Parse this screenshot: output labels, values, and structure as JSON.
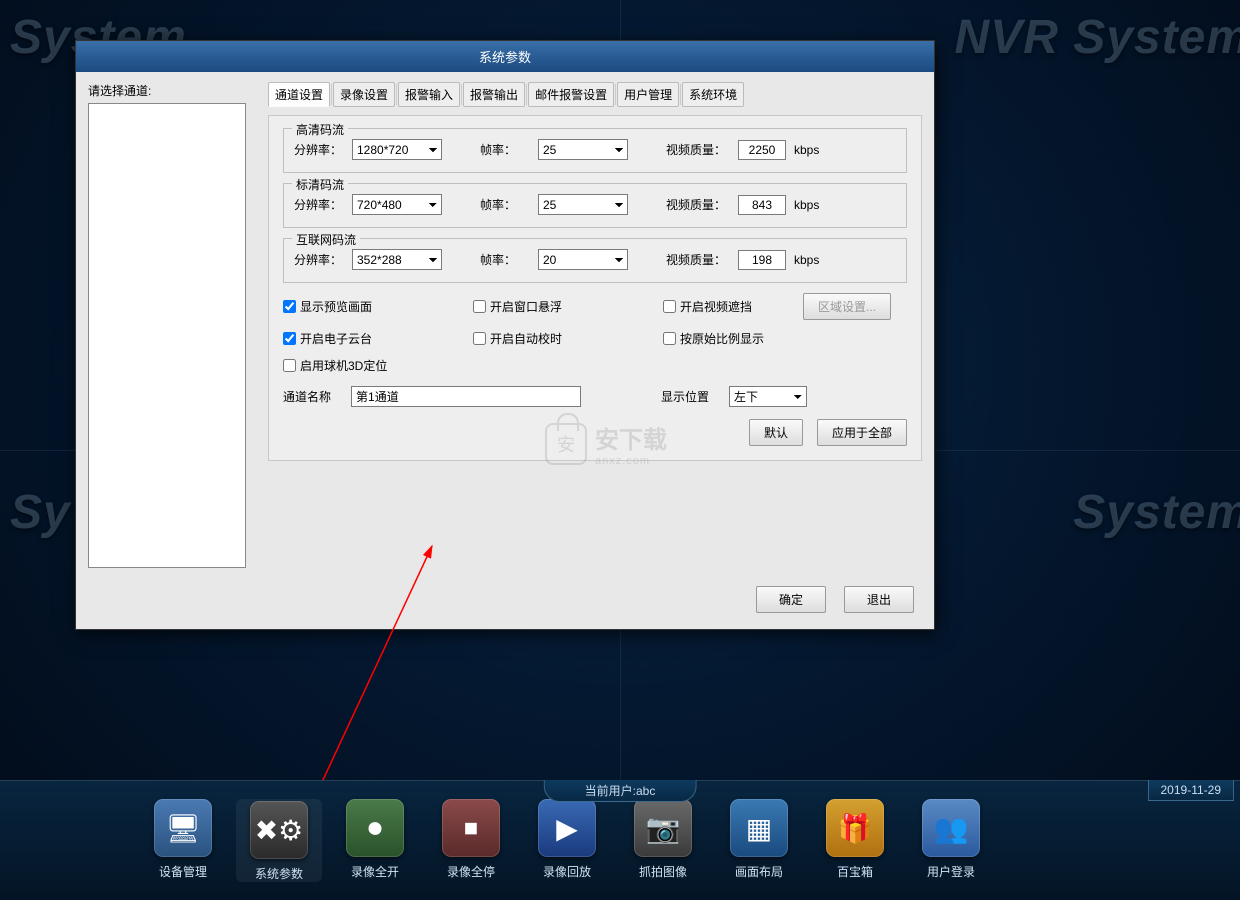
{
  "bg": {
    "t": "System",
    "tr": "NVR System",
    "bl": "Sy",
    "br": "System"
  },
  "dialog": {
    "title": "系统参数",
    "select_channel": "请选择通道:",
    "tabs": [
      "通道设置",
      "录像设置",
      "报警输入",
      "报警输出",
      "邮件报警设置",
      "用户管理",
      "系统环境"
    ],
    "active_tab": 0,
    "streams": [
      {
        "legend": "高清码流",
        "res": "1280*720",
        "fps": "25",
        "quality": "2250"
      },
      {
        "legend": "标清码流",
        "res": "720*480",
        "fps": "25",
        "quality": "843"
      },
      {
        "legend": "互联网码流",
        "res": "352*288",
        "fps": "20",
        "quality": "198"
      }
    ],
    "labels": {
      "res": "分辨率：",
      "fps": "帧率：",
      "quality": "视频质量：",
      "kbps": "kbps"
    },
    "checks": {
      "preview": "显示预览画面",
      "float": "开启窗口悬浮",
      "mask": "开启视频遮挡",
      "ptz": "开启电子云台",
      "autotime": "开启自动校时",
      "ratio": "按原始比例显示",
      "dome3d": "启用球机3D定位"
    },
    "check_states": {
      "preview": true,
      "float": false,
      "mask": false,
      "ptz": true,
      "autotime": false,
      "ratio": false,
      "dome3d": false
    },
    "region_btn": "区域设置...",
    "chname_label": "通道名称",
    "chname_value": "第1通道",
    "pos_label": "显示位置",
    "pos_value": "左下",
    "default_btn": "默认",
    "applyall_btn": "应用于全部",
    "ok_btn": "确定",
    "exit_btn": "退出"
  },
  "watermark": {
    "ch": "安",
    "brand": "安下载",
    "url": "anxz.com"
  },
  "taskbar": {
    "user_prefix": "当前用户:",
    "user": "abc",
    "date": "2019-11-29",
    "items": [
      {
        "label": "设备管理",
        "icon": "🖥"
      },
      {
        "label": "系统参数",
        "icon": "✖⚙"
      },
      {
        "label": "录像全开",
        "icon": "⏺"
      },
      {
        "label": "录像全停",
        "icon": "⏹"
      },
      {
        "label": "录像回放",
        "icon": "▶"
      },
      {
        "label": "抓拍图像",
        "icon": "📷"
      },
      {
        "label": "画面布局",
        "icon": "▦"
      },
      {
        "label": "百宝箱",
        "icon": "🎁"
      },
      {
        "label": "用户登录",
        "icon": "👥"
      }
    ],
    "active": 1
  }
}
